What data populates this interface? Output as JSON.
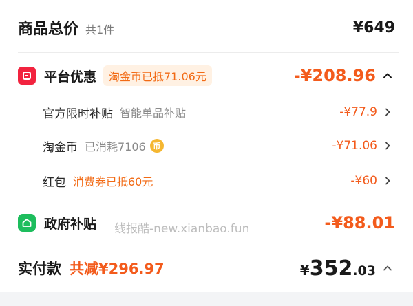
{
  "total": {
    "title": "商品总价",
    "count": "共1件",
    "price": "¥649"
  },
  "platform": {
    "title": "平台优惠",
    "tag": "淘金币已抵71.06元",
    "amount": "-¥208.96",
    "icon": "platform-discount-icon",
    "color": "#f2233f"
  },
  "items": {
    "official": {
      "label": "官方限时补贴",
      "note": "智能单品补贴",
      "amount": "-¥77.9"
    },
    "coin": {
      "label": "淘金币",
      "note": "已消耗7106",
      "coin_glyph": "币",
      "amount": "-¥71.06"
    },
    "redpack": {
      "label": "红包",
      "note": "消费券已抵60元",
      "amount": "-¥60"
    }
  },
  "gov": {
    "title": "政府补贴",
    "amount": "-¥88.01",
    "icon": "home-icon",
    "color": "#1dbd5d"
  },
  "watermark": "线报酷-new.xianbao.fun",
  "actual": {
    "title": "实付款",
    "saved": "共减¥296.97",
    "currency": "¥",
    "integer": "352",
    "decimal": ".03"
  },
  "colors": {
    "accent_orange": "#f35b1c",
    "tag_bg": "#fff1e3",
    "text_dark": "#1a1a1a",
    "text_gray": "#8a8a8a"
  }
}
